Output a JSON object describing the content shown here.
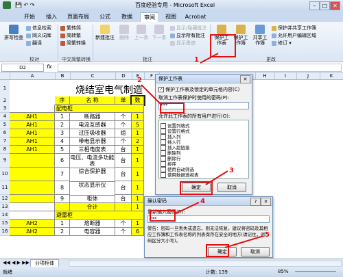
{
  "window": {
    "title": "百度经验专用 - Microsoft Excel"
  },
  "ribbon": {
    "tabs": [
      "开始",
      "插入",
      "页面布局",
      "公式",
      "数据",
      "审阅",
      "视图",
      "Acrobat"
    ],
    "active_tab": "审阅",
    "proofing": {
      "spell": "拼写检查",
      "info": "信息检索",
      "thesaurus": "同义词库",
      "translate": "翻译",
      "group": "校对"
    },
    "chinese": {
      "to_trad": "繁转简",
      "to_simp": "简转繁",
      "convert": "简繁转换",
      "group": "中文简繁转换"
    },
    "comments": {
      "new": "新建批注",
      "delete": "删除",
      "prev": "上一条",
      "next": "下一条",
      "show_hide": "显示/隐藏批注",
      "show_all": "显示所有批注",
      "show_ink": "显示墨迹",
      "group": "批注"
    },
    "changes": {
      "protect_sheet": "保护工作表",
      "protect_book": "保护工作簿",
      "share": "共享工作簿",
      "protect_share": "保护并共享工作簿",
      "allow_edit": "允许用户编辑区域",
      "track": "修订",
      "group": "更改"
    }
  },
  "formula_bar": {
    "name_box": "D2",
    "fx": "fx"
  },
  "sheet": {
    "title": "烧结室电气制造",
    "columns": [
      "A",
      "B",
      "C",
      "D",
      "E",
      "F",
      "G",
      "H",
      "I",
      "J",
      "K"
    ],
    "header": {
      "seq": "序",
      "name": "名 称",
      "unit": "单",
      "qty": "数"
    },
    "section1": "配电柜",
    "rows": [
      {
        "row": "3",
        "a": "",
        "seq": "",
        "name": "配电柜",
        "unit": "",
        "qty": ""
      },
      {
        "row": "4",
        "a": "AH1",
        "seq": "1",
        "name": "断路器",
        "unit": "个",
        "qty": "1"
      },
      {
        "row": "5",
        "a": "AH1",
        "seq": "2",
        "name": "电流互感器",
        "unit": "个",
        "qty": "5"
      },
      {
        "row": "6",
        "a": "AH1",
        "seq": "3",
        "name": "过压吸收器",
        "unit": "组",
        "qty": "1"
      },
      {
        "row": "7",
        "a": "AH1",
        "seq": "4",
        "name": "带电显示器",
        "unit": "个",
        "qty": "2"
      },
      {
        "row": "8",
        "a": "AH1",
        "seq": "5",
        "name": "三相电度表",
        "unit": "台",
        "qty": "1"
      },
      {
        "row": "9",
        "a": "",
        "seq": "6",
        "name": "电压、电流多功能表",
        "unit": "台",
        "qty": "1"
      },
      {
        "row": "10",
        "a": "",
        "seq": "7",
        "name": "综合保护器",
        "unit": "台",
        "qty": "1"
      },
      {
        "row": "11",
        "a": "",
        "seq": "8",
        "name": "状态显示仪",
        "unit": "台",
        "qty": "1"
      },
      {
        "row": "12",
        "a": "",
        "seq": "9",
        "name": "柜体",
        "unit": "台",
        "qty": "1"
      },
      {
        "row": "13",
        "a": "",
        "seq": "",
        "name": "合计",
        "unit": "",
        "qty": "1"
      },
      {
        "row": "14",
        "a": "",
        "seq": "",
        "name": "避雷柜",
        "unit": "",
        "qty": ""
      },
      {
        "row": "15",
        "a": "AH2",
        "seq": "1",
        "name": "熔断器",
        "unit": "个",
        "qty": "1"
      },
      {
        "row": "16",
        "a": "AH2",
        "seq": "2",
        "name": "电容器",
        "unit": "个",
        "qty": "6"
      }
    ],
    "tab_name": "分项柜体"
  },
  "protect_dialog": {
    "title": "保护工作表",
    "protect_check": "保护工作表及锁定的单元格内容(C)",
    "password_label": "取消工作表保护时使用的密码(P):",
    "password_value": "***",
    "allow_label": "允许此工作表的所有用户进行(O):",
    "options": [
      "设置列格式",
      "设置行格式",
      "插入列",
      "插入行",
      "插入超链接",
      "删除列",
      "删除行",
      "排序",
      "使用自动筛选",
      "使用数据透视表"
    ],
    "ok": "确定",
    "cancel": "取消"
  },
  "confirm_dialog": {
    "title": "确认密码",
    "reenter_label": "重新输入密码(R):",
    "password_value": "***",
    "warning": "警告：密码一旦丢失或遗忘，则无法恢复。建议将密码及其相应工作簿和工作表名称的列表保存在安全的地方(请记住，密码区分大小写)。",
    "ok": "确定",
    "cancel": "取消"
  },
  "annotations": [
    "1",
    "2",
    "3",
    "4",
    "5"
  ],
  "status": {
    "left": "就绪",
    "count": "计数: 139",
    "zoom": "85%"
  },
  "colors": {
    "highlight": "#ffff00",
    "accent_red": "#e01010"
  }
}
